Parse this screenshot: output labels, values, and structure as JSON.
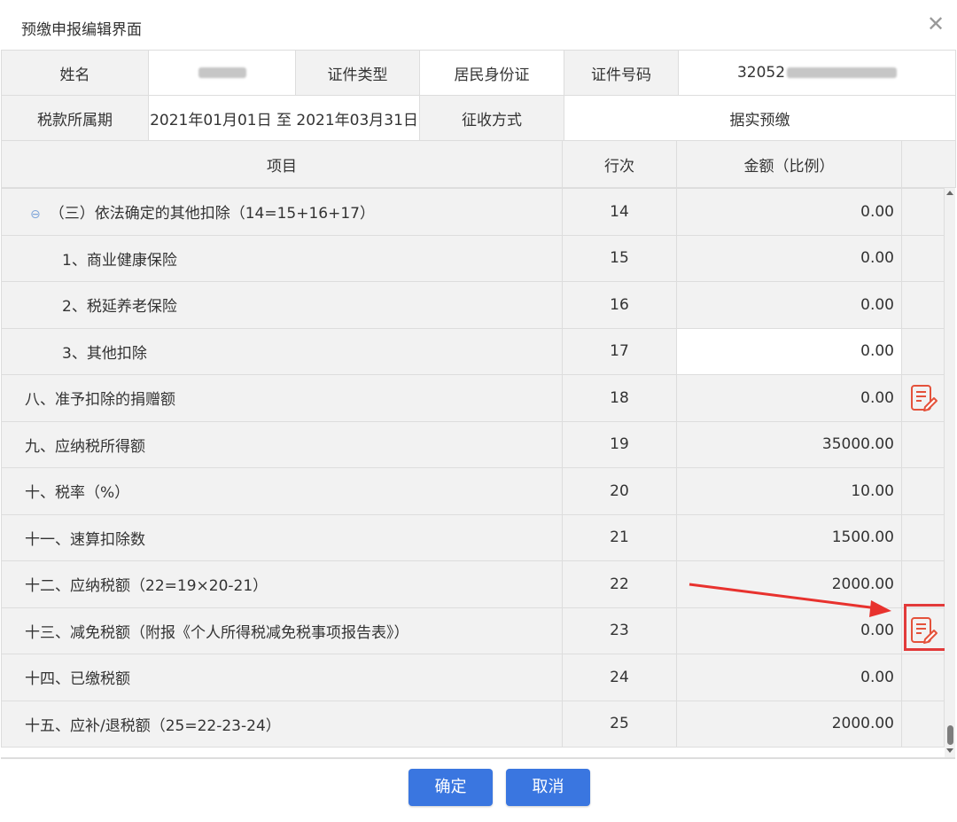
{
  "dialog": {
    "title": "预缴申报编辑界面",
    "close_glyph": "✕"
  },
  "info": {
    "name_label": "姓名",
    "id_type_label": "证件类型",
    "id_type_value": "居民身份证",
    "id_no_label": "证件号码",
    "id_no_prefix": "32052",
    "period_label": "税款所属期",
    "period_value": "2021年01月01日 至 2021年03月31日",
    "method_label": "征收方式",
    "method_value": "据实预缴"
  },
  "grid": {
    "headers": {
      "item": "项目",
      "line": "行次",
      "amount": "金额（比例）"
    },
    "rows": [
      {
        "item": "（三）依法确定的其他扣除（14=15+16+17）",
        "line": "14",
        "amount": "0.00",
        "group": true
      },
      {
        "item": "1、商业健康保险",
        "line": "15",
        "amount": "0.00",
        "sub": true
      },
      {
        "item": "2、税延养老保险",
        "line": "16",
        "amount": "0.00",
        "sub": true
      },
      {
        "item": "3、其他扣除",
        "line": "17",
        "amount": "0.00",
        "sub": true,
        "editable": true
      },
      {
        "item": "八、准予扣除的捐赠额",
        "line": "18",
        "amount": "0.00",
        "icon": true
      },
      {
        "item": "九、应纳税所得额",
        "line": "19",
        "amount": "35000.00"
      },
      {
        "item": "十、税率（%）",
        "line": "20",
        "amount": "10.00"
      },
      {
        "item": "十一、速算扣除数",
        "line": "21",
        "amount": "1500.00"
      },
      {
        "item": "十二、应纳税额（22=19×20-21）",
        "line": "22",
        "amount": "2000.00"
      },
      {
        "item": "十三、减免税额（附报《个人所得税减免税事项报告表》）",
        "line": "23",
        "amount": "0.00",
        "icon": true,
        "highlight": true
      },
      {
        "item": "十四、已缴税额",
        "line": "24",
        "amount": "0.00"
      },
      {
        "item": "十五、应补/退税额（25=22-23-24）",
        "line": "25",
        "amount": "2000.00"
      }
    ]
  },
  "buttons": {
    "confirm": "确定",
    "cancel": "取消"
  },
  "icons": {
    "edit": "edit-form-icon",
    "collapse": "minus-circle-icon",
    "close": "close-icon"
  },
  "colors": {
    "accent": "#3a76e0",
    "icon": "#e4523b",
    "highlight": "#e23a3a"
  }
}
